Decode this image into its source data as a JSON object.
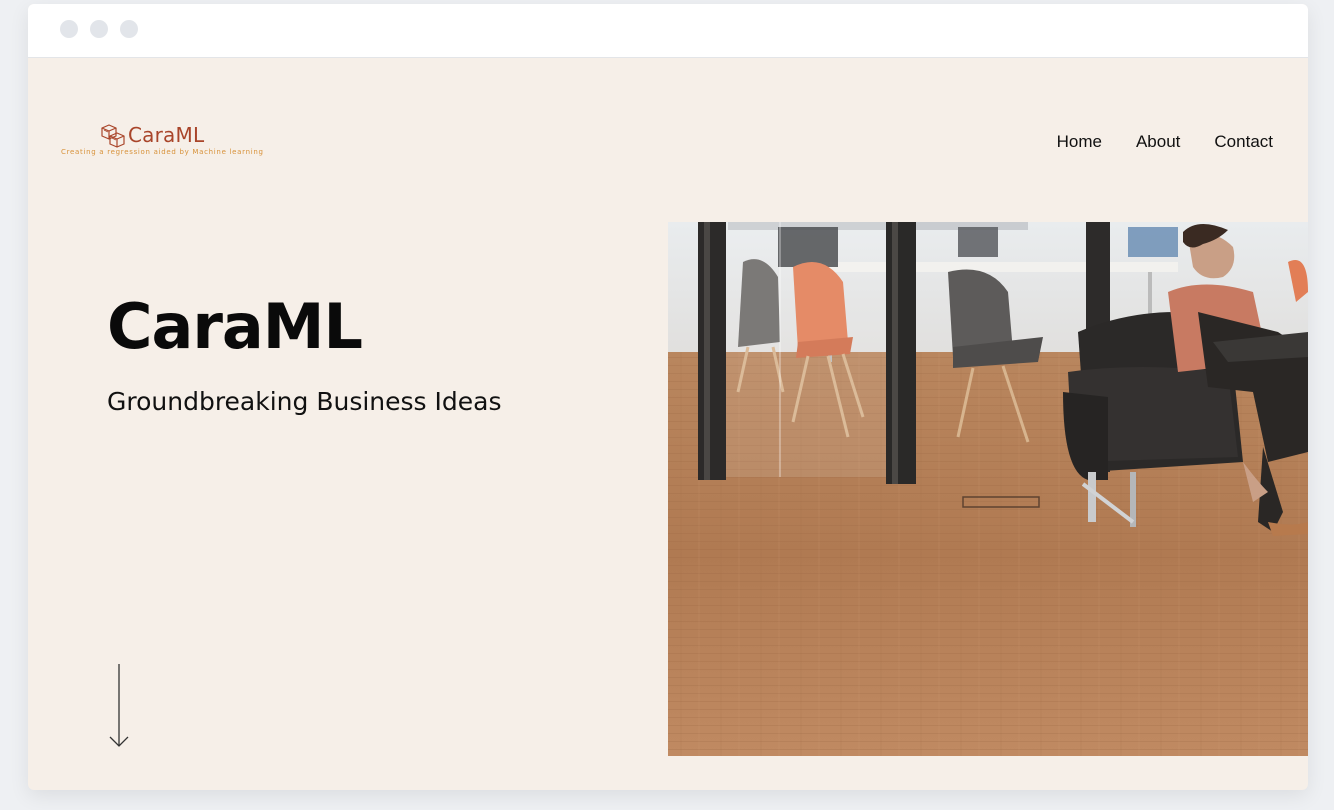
{
  "window": {
    "controls": [
      "close",
      "minimize",
      "maximize"
    ]
  },
  "brand": {
    "name": "CaraML",
    "tagline": "Creating a regression aided by Machine learning",
    "color": "#a9452a",
    "tagline_color": "#d8923a",
    "icon": "cube-boxes-icon"
  },
  "nav": {
    "items": [
      {
        "label": "Home"
      },
      {
        "label": "About"
      },
      {
        "label": "Contact"
      }
    ]
  },
  "hero": {
    "title": "CaraML",
    "subtitle": "Groundbreaking Business Ideas",
    "scroll_icon": "arrow-down-icon",
    "photo_icon": "office-lounge-photo"
  },
  "colors": {
    "page_background": "#f6efe8",
    "text": "#0a0a0a"
  }
}
